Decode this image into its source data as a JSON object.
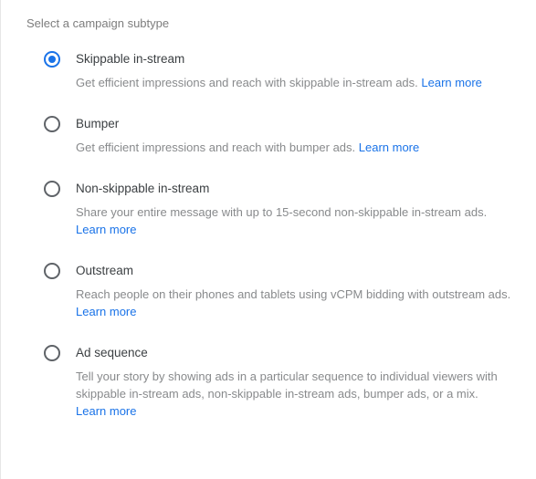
{
  "section_title": "Select a campaign subtype",
  "learn_more_label": "Learn more",
  "options": [
    {
      "title": "Skippable in-stream",
      "description": "Get efficient impressions and reach with skippable in-stream ads.",
      "selected": true,
      "learn_inline": true
    },
    {
      "title": "Bumper",
      "description": "Get efficient impressions and reach with bumper ads.",
      "selected": false,
      "learn_inline": true
    },
    {
      "title": "Non-skippable in-stream",
      "description": "Share your entire message with up to 15-second non-skippable in-stream ads.",
      "selected": false,
      "learn_inline": false
    },
    {
      "title": "Outstream",
      "description": "Reach people on their phones and tablets using vCPM bidding with outstream ads.",
      "selected": false,
      "learn_inline": true
    },
    {
      "title": "Ad sequence",
      "description": "Tell your story by showing ads in a particular sequence to individual viewers with skippable in-stream ads, non-skippable in-stream ads, bumper ads, or a mix.",
      "selected": false,
      "learn_inline": false
    }
  ]
}
